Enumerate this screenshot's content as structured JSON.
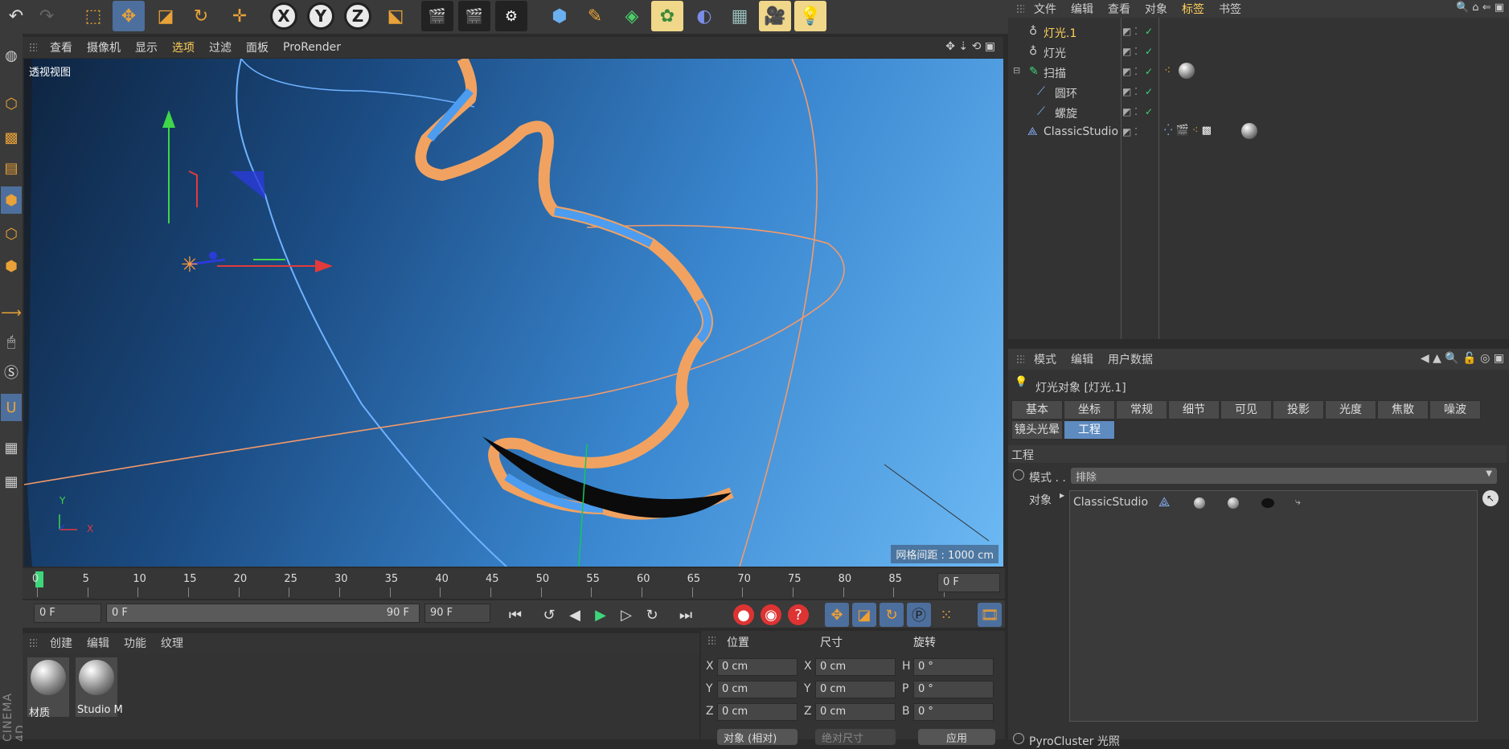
{
  "top_toolbar": {
    "icons": [
      "undo-icon",
      "redo-icon",
      "select-icon",
      "move-icon",
      "scale-icon",
      "rotate-icon",
      "transform-icon",
      "x-axis-lock",
      "y-axis-lock",
      "z-axis-lock",
      "coordinate-system-icon",
      "render-view-icon",
      "render-to-picture-viewer-icon",
      "render-settings-icon",
      "cube-icon",
      "pen-icon",
      "subdivision-icon",
      "cloner-icon",
      "deformer-icon",
      "floor-icon",
      "camera-icon",
      "light-icon"
    ],
    "x_label": "X",
    "y_label": "Y",
    "z_label": "Z"
  },
  "viewport": {
    "menu": [
      "查看",
      "摄像机",
      "显示",
      "选项",
      "过滤",
      "面板",
      "ProRender"
    ],
    "active_menu": "选项",
    "label": "透视视图",
    "grid_spacing": "网格间距 : 1000 cm",
    "axis_y": "Y",
    "axis_x": "X"
  },
  "timeline": {
    "ticks": [
      "0",
      "5",
      "10",
      "15",
      "20",
      "25",
      "30",
      "35",
      "40",
      "45",
      "50",
      "55",
      "60",
      "65",
      "70",
      "75",
      "80",
      "85",
      "90"
    ],
    "current_frame": "0 F",
    "start_frame": "0 F",
    "range_start": "0 F",
    "range_end": "90 F",
    "end_frame": "90 F"
  },
  "material_manager": {
    "menu": [
      "创建",
      "编辑",
      "功能",
      "纹理"
    ],
    "materials": [
      "材质",
      "Studio M"
    ]
  },
  "coord_manager": {
    "headers": [
      "位置",
      "尺寸",
      "旋转"
    ],
    "rows": [
      {
        "pos_axis": "X",
        "pos": "0 cm",
        "size_axis": "X",
        "size": "0 cm",
        "rot_axis": "H",
        "rot": "0 °"
      },
      {
        "pos_axis": "Y",
        "pos": "0 cm",
        "size_axis": "Y",
        "size": "0 cm",
        "rot_axis": "P",
        "rot": "0 °"
      },
      {
        "pos_axis": "Z",
        "pos": "0 cm",
        "size_axis": "Z",
        "size": "0 cm",
        "rot_axis": "B",
        "rot": "0 °"
      }
    ],
    "mode_button": "对象 (相对)",
    "size_button": "绝对尺寸",
    "apply_button": "应用"
  },
  "object_manager": {
    "menu": [
      "文件",
      "编辑",
      "查看",
      "对象",
      "标签",
      "书签"
    ],
    "active_menu": "标签",
    "objects": [
      {
        "name": "灯光.1",
        "selected": true
      },
      {
        "name": "灯光",
        "selected": false
      },
      {
        "name": "扫描",
        "selected": false
      },
      {
        "name": "圆环",
        "selected": false
      },
      {
        "name": "螺旋",
        "selected": false
      },
      {
        "name": "ClassicStudio",
        "selected": false
      }
    ]
  },
  "attribute_manager": {
    "menu": [
      "模式",
      "编辑",
      "用户数据"
    ],
    "title": "灯光对象 [灯光.1]",
    "tabs_row1": [
      "基本",
      "坐标",
      "常规",
      "细节",
      "可见",
      "投影",
      "光度",
      "焦散",
      "噪波"
    ],
    "tabs_row2": [
      "镜头光晕",
      "工程"
    ],
    "active_tab": "工程",
    "section": "工程",
    "mode_label": "模式 . .",
    "mode_value": "排除",
    "objects_label": "对象",
    "objects_value": "ClassicStudio",
    "footer_item": "PyroCluster 光照"
  },
  "colors": {
    "accent": "#ffd15c",
    "selection": "#4d6f9d",
    "tab_active": "#5e8bc0",
    "orange": "#e8a238"
  }
}
